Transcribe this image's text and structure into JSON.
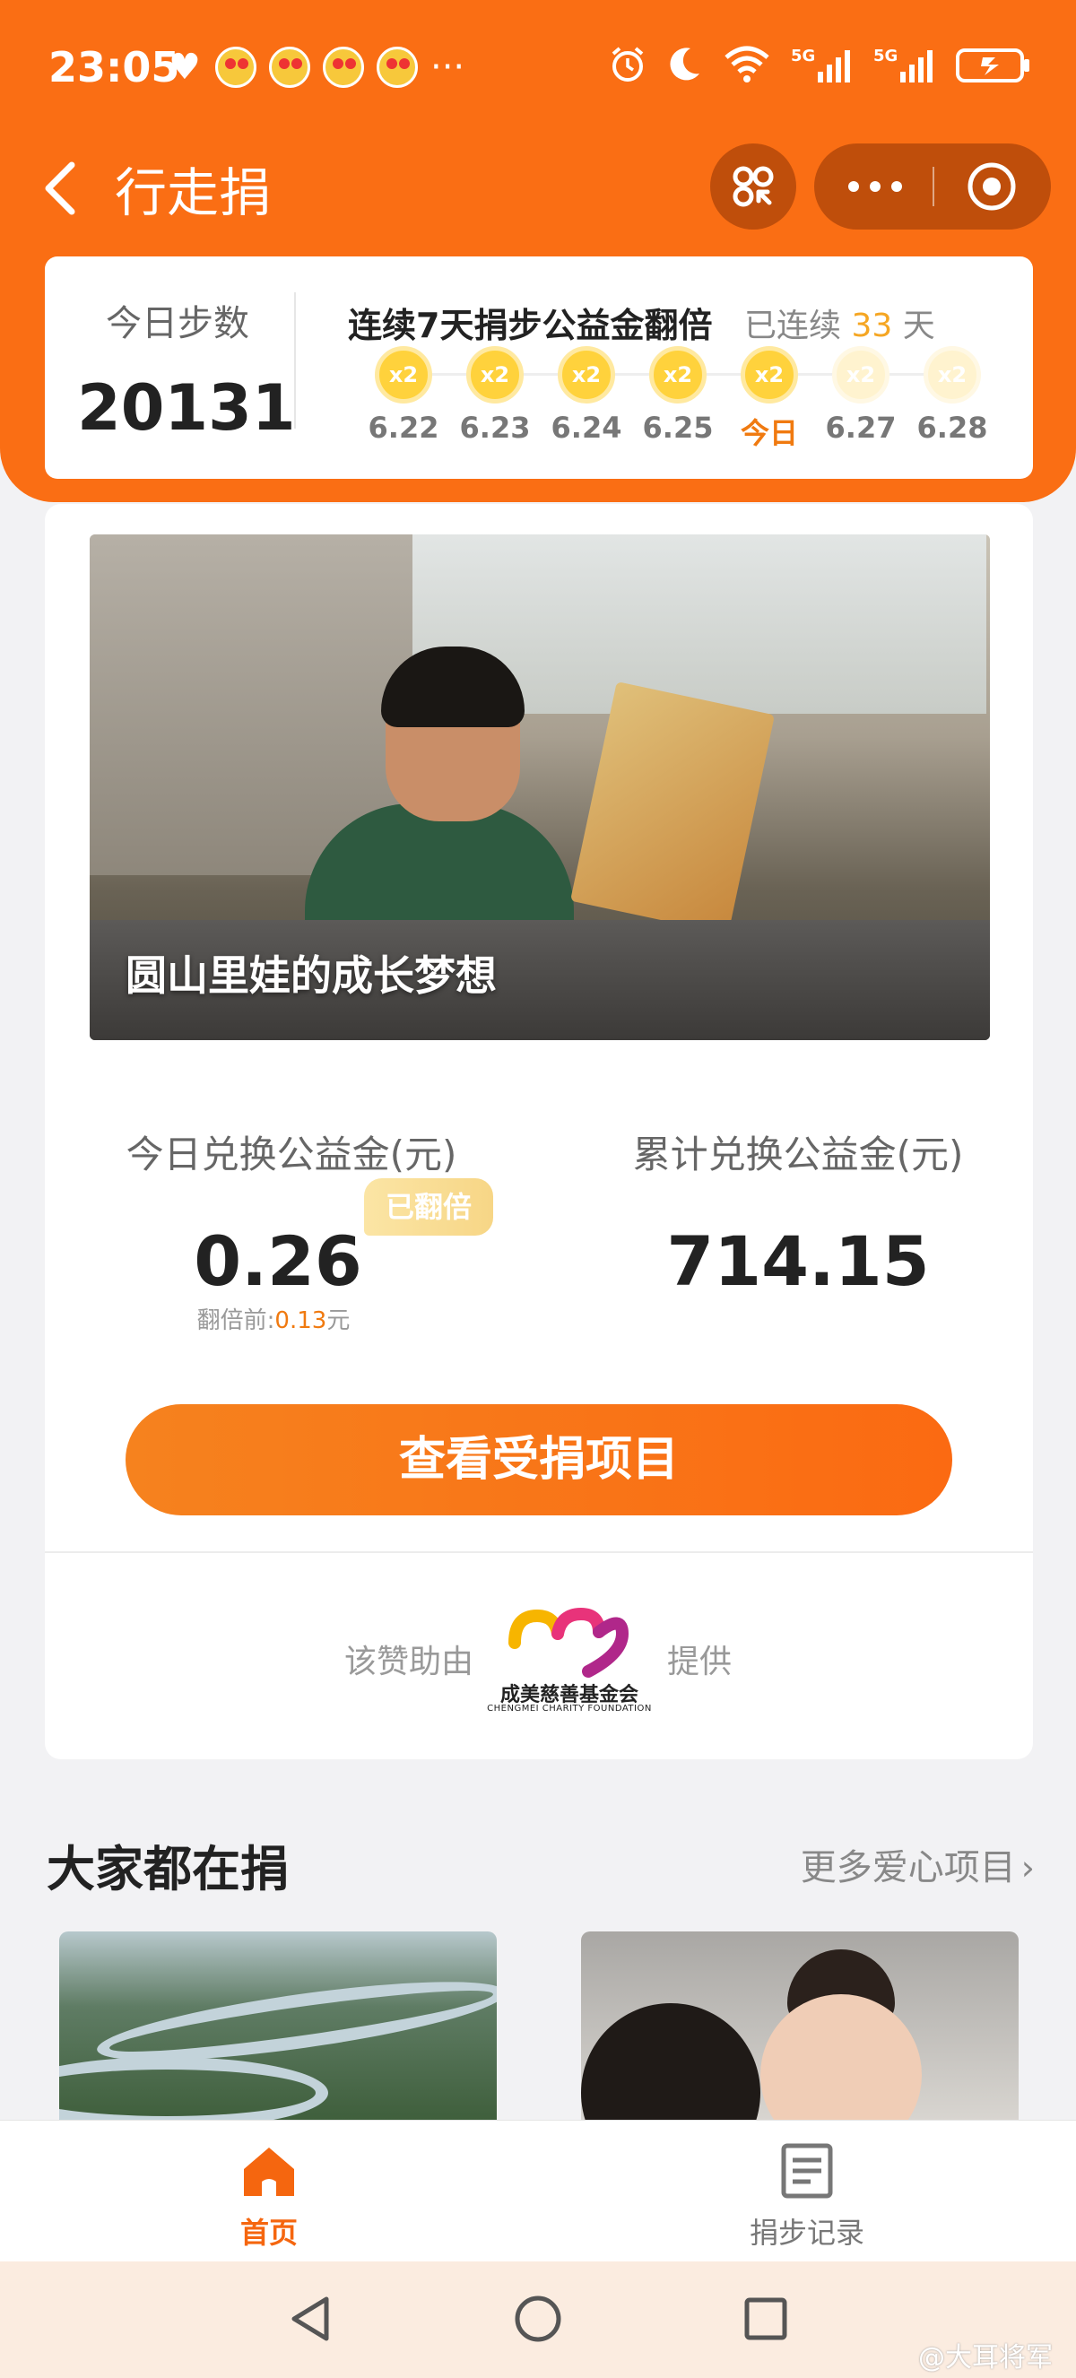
{
  "status_bar": {
    "time": "23:05",
    "dots": "···",
    "icons": [
      "heart-icon",
      "weibo-icon",
      "alarm-icon",
      "moon-icon",
      "wifi-icon",
      "signal-5g-icon",
      "battery-charging-icon"
    ]
  },
  "nav": {
    "title": "行走捐"
  },
  "steps": {
    "label": "今日步数",
    "value": "20131"
  },
  "streak": {
    "title": "连续7天捐步公益金翻倍",
    "sub_prefix": "已连续",
    "days": "33",
    "sub_suffix": "天",
    "coin_label": "x2",
    "dates": [
      {
        "label": "6.22",
        "state": "done"
      },
      {
        "label": "6.23",
        "state": "done"
      },
      {
        "label": "6.24",
        "state": "done"
      },
      {
        "label": "6.25",
        "state": "done"
      },
      {
        "label": "今日",
        "state": "today"
      },
      {
        "label": "6.27",
        "state": "future"
      },
      {
        "label": "6.28",
        "state": "future"
      }
    ]
  },
  "project": {
    "caption": "圆山里娃的成长梦想"
  },
  "donation": {
    "today_label": "今日兑换公益金(元)",
    "today_value": "0.26",
    "doubled_badge": "已翻倍",
    "pre_double_label": "翻倍前:",
    "pre_double_amount": "0.13",
    "pre_double_unit": "元",
    "total_label": "累计兑换公益金(元)",
    "total_value": "714.15"
  },
  "cta": {
    "view_projects": "查看受捐项目"
  },
  "sponsor": {
    "prefix": "该赞助由",
    "suffix": "提供",
    "foundation_name": "成美慈善基金会",
    "foundation_en": "CHENGMEI CHARITY FOUNDATION"
  },
  "section": {
    "title": "大家都在捐",
    "more": "更多爱心项目"
  },
  "tabs": [
    {
      "label": "首页",
      "active": true
    },
    {
      "label": "捐步记录",
      "active": false
    }
  ],
  "watermark": "@大耳将军",
  "colors": {
    "brand_orange": "#fa6e14",
    "accent_gold": "#f5a623",
    "active_tab": "#f5660f"
  }
}
